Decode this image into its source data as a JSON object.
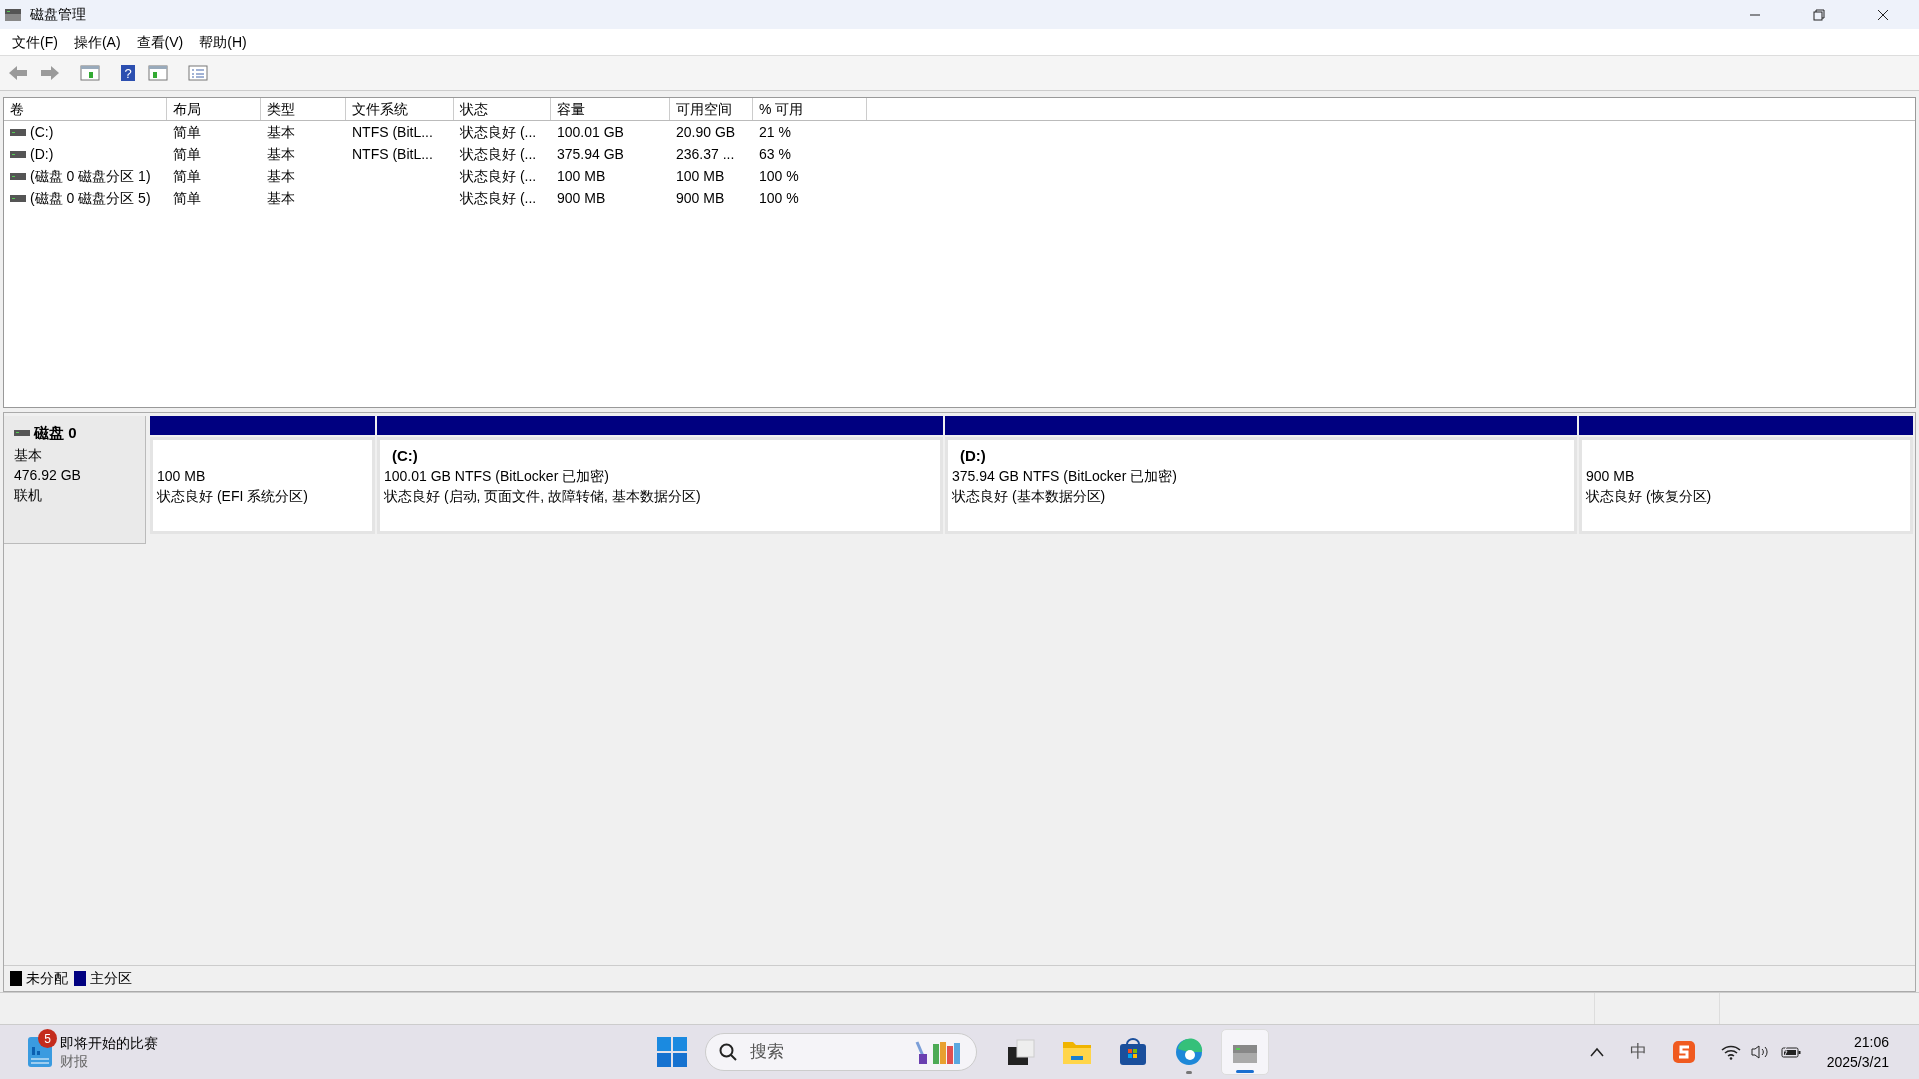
{
  "window": {
    "title": "磁盘管理"
  },
  "menu": [
    "文件(F)",
    "操作(A)",
    "查看(V)",
    "帮助(H)"
  ],
  "toolbar": {
    "help_glyph": "?"
  },
  "volume_table": {
    "columns": [
      "卷",
      "布局",
      "类型",
      "文件系统",
      "状态",
      "容量",
      "可用空间",
      "% 可用"
    ],
    "rows": [
      [
        "(C:)",
        "简单",
        "基本",
        "NTFS (BitL...",
        "状态良好 (...",
        "100.01 GB",
        "20.90 GB",
        "21 %"
      ],
      [
        "(D:)",
        "简单",
        "基本",
        "NTFS (BitL...",
        "状态良好 (...",
        "375.94 GB",
        "236.37 ...",
        "63 %"
      ],
      [
        "(磁盘 0 磁盘分区 1)",
        "简单",
        "基本",
        null,
        "状态良好 (...",
        "100 MB",
        "100 MB",
        "100 %"
      ],
      [
        "(磁盘 0 磁盘分区 5)",
        "简单",
        "基本",
        null,
        "状态良好 (...",
        "900 MB",
        "900 MB",
        "100 %"
      ]
    ]
  },
  "disk": {
    "name": "磁盘 0",
    "type": "基本",
    "size": "476.92 GB",
    "state": "联机",
    "partitions": [
      {
        "size": "100 MB",
        "status": "状态良好 (EFI 系统分区)",
        "color": "#000080"
      },
      {
        "label": "(C:)",
        "size": "100.01 GB NTFS (BitLocker 已加密)",
        "status": "状态良好 (启动, 页面文件, 故障转储, 基本数据分区)",
        "color": "#000080"
      },
      {
        "label": "(D:)",
        "size": "375.94 GB NTFS (BitLocker 已加密)",
        "status": "状态良好 (基本数据分区)",
        "color": "#000080"
      },
      {
        "size": "900 MB",
        "status": "状态良好 (恢复分区)",
        "color": "#000080"
      }
    ]
  },
  "legend": [
    {
      "label": "未分配",
      "color": "#000000"
    },
    {
      "label": "主分区",
      "color": "#000080"
    }
  ],
  "taskbar": {
    "widget": {
      "badge": "5",
      "title": "即将开始的比赛",
      "subtitle": "财报"
    },
    "search": {
      "placeholder": "搜索"
    },
    "apps": [
      {
        "kind": "taskview",
        "selected": false,
        "running": false
      },
      {
        "kind": "folder",
        "selected": false,
        "running": false
      },
      {
        "kind": "store",
        "selected": false,
        "running": false
      },
      {
        "kind": "browser",
        "selected": false,
        "running": true
      },
      {
        "kind": "diskmgmt",
        "selected": true,
        "running": true
      }
    ],
    "ime": "中",
    "time": "21:06",
    "date": "2025/3/21"
  }
}
